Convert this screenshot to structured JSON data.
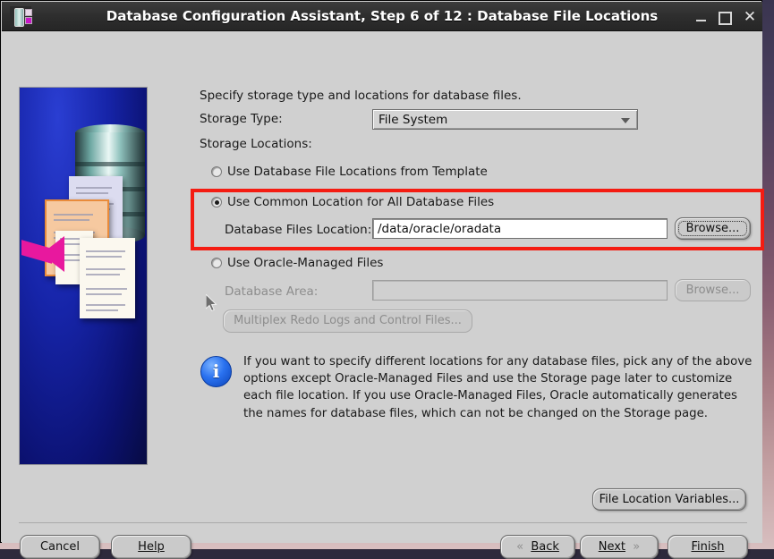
{
  "window": {
    "title": "Database Configuration Assistant, Step 6 of 12 : Database File Locations",
    "icon": "database-app-icon",
    "controls": {
      "minimize": "minimize-icon",
      "maximize": "maximize-icon",
      "close": "close-icon"
    }
  },
  "main": {
    "intro": "Specify storage type and locations for database files.",
    "storage_type_label": "Storage Type:",
    "storage_type_value": "File System",
    "storage_locations_label": "Storage Locations:",
    "options": [
      {
        "label": "Use Database File Locations from Template",
        "selected": false,
        "enabled": true
      },
      {
        "label": "Use Common Location for All Database Files",
        "selected": true,
        "enabled": true
      },
      {
        "label": "Use Oracle-Managed Files",
        "selected": false,
        "enabled": true
      }
    ],
    "db_files_location_label": "Database Files Location:",
    "db_files_location_value": "/data/oracle/oradata",
    "browse_label": "Browse...",
    "database_area_label": "Database Area:",
    "database_area_value": "",
    "browse_2_label": "Browse...",
    "multiplex_label": "Multiplex Redo Logs and Control Files...",
    "info_text": "If you want to specify different locations for any database files, pick any of the above options except Oracle-Managed Files and use the Storage page later to customize each file location. If you use Oracle-Managed Files, Oracle automatically generates the names for database files, which can not be changed on the Storage page.",
    "file_location_variables_label": "File Location Variables...",
    "highlight_color": "#f41c12"
  },
  "footer": {
    "cancel": "Cancel",
    "help": "Help",
    "back": "Back",
    "next": "Next",
    "finish": "Finish",
    "back_chevron": "«",
    "next_chevron": "»"
  },
  "sidebar_art": {
    "name": "database-files-illustration"
  }
}
